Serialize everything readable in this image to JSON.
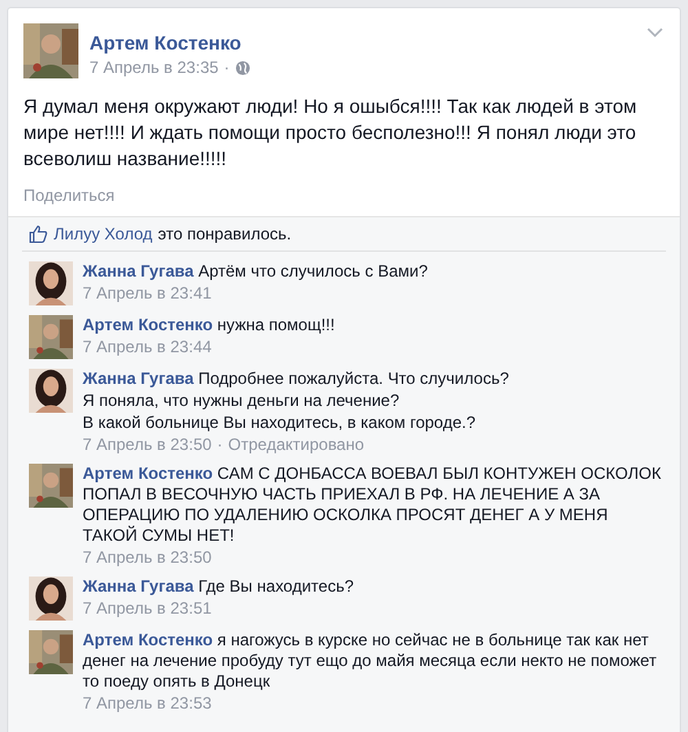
{
  "post": {
    "author": {
      "name": "Артем Костенко"
    },
    "time": "7 Апрель в 23:35",
    "separator": "·",
    "text": "Я думал меня окружают люди! Но я ошыбся!!!! Так как людей в этом мире нет!!!! И ждать помощи просто бесполезно!!! Я понял люди это всеволиш название!!!!!",
    "share": "Поделиться"
  },
  "likes": {
    "name": "Лилуу Холод",
    "text": "это понравилось."
  },
  "comments": [
    {
      "lines": [
        "**Жанна Гугава** Артём что случилось с Вами?"
      ],
      "time": "7 Апрель в 23:41"
    },
    {
      "lines": [
        "**Артем Костенко** нужна помощ!!!"
      ],
      "time": "7 Апрель в 23:44"
    },
    {
      "lines": [
        "**Жанна Гугава** Подробнее пожалуйста. Что случилось?",
        "Я поняла, что нужны деньги на лечение?",
        "В какой больнице Вы находитесь, в каком городе.?"
      ],
      "time": "7 Апрель в 23:50",
      "separator": "·",
      "edited": "Отредактировано"
    },
    {
      "lines": [
        "**Артем Костенко** САМ С ДОНБАССА ВОЕВАЛ БЫЛ КОНТУЖЕН ОСКОЛОК ПОПАЛ В ВЕСОЧНУЮ ЧАСТЬ ПРИЕХАЛ В РФ. НА ЛЕЧЕНИЕ А ЗА ОПЕРАЦИЮ ПО УДАЛЕНИЮ ОСКОЛКА ПРОСЯТ ДЕНЕГ А У МЕНЯ ТАКОЙ СУМЫ НЕТ!"
      ],
      "time": "7 Апрель в 23:50"
    },
    {
      "lines": [
        "**Жанна Гугава** Где Вы находитесь?"
      ],
      "time": "7 Апрель в 23:51"
    },
    {
      "lines": [
        "**Артем Костенко** я нагожусь в курске но сейчас не в больнице так как нет денег на лечение пробуду тут ещо до майя месяца если некто не поможет то поеду опять в Донецк"
      ],
      "time": "7 Апрель в 23:53"
    }
  ]
}
